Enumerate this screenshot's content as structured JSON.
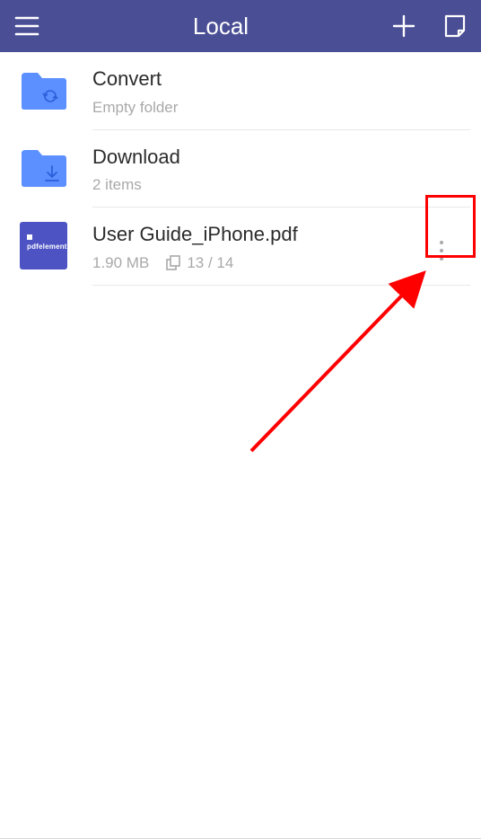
{
  "header": {
    "title": "Local"
  },
  "items": [
    {
      "type": "folder",
      "name": "Convert",
      "subtitle": "Empty folder",
      "icon": "sync"
    },
    {
      "type": "folder",
      "name": "Download",
      "subtitle": "2 items",
      "icon": "download"
    },
    {
      "type": "file",
      "name": "User Guide_iPhone.pdf",
      "size": "1.90 MB",
      "pages": "13 / 14",
      "thumb_label": "pdfelement"
    }
  ],
  "colors": {
    "header_bg": "#4a4e95",
    "folder_fill": "#5c8fff",
    "file_thumb": "#4d53c3",
    "annotation": "#ff0000"
  }
}
